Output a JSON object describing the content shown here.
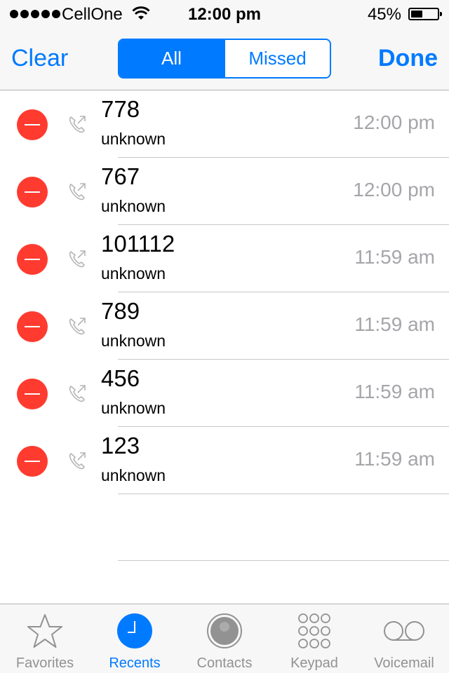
{
  "status_bar": {
    "carrier": "CellOne",
    "time": "12:00 pm",
    "battery_percent": "45%",
    "battery_level": 0.45
  },
  "nav": {
    "clear_label": "Clear",
    "done_label": "Done",
    "segments": [
      "All",
      "Missed"
    ],
    "selected_segment": "All"
  },
  "calls": [
    {
      "number": "778",
      "label": "unknown",
      "time": "12:00 pm"
    },
    {
      "number": "767",
      "label": "unknown",
      "time": "12:00 pm"
    },
    {
      "number": "101112",
      "label": "unknown",
      "time": "11:59 am"
    },
    {
      "number": "789",
      "label": "unknown",
      "time": "11:59 am"
    },
    {
      "number": "456",
      "label": "unknown",
      "time": "11:59 am"
    },
    {
      "number": "123",
      "label": "unknown",
      "time": "11:59 am"
    }
  ],
  "tabs": [
    {
      "label": "Favorites",
      "icon": "star-icon"
    },
    {
      "label": "Recents",
      "icon": "clock-icon",
      "active": true
    },
    {
      "label": "Contacts",
      "icon": "contact-icon"
    },
    {
      "label": "Keypad",
      "icon": "keypad-icon"
    },
    {
      "label": "Voicemail",
      "icon": "voicemail-icon"
    }
  ],
  "colors": {
    "accent": "#007aff",
    "delete": "#ff3b30",
    "muted": "#a5a5aa"
  }
}
